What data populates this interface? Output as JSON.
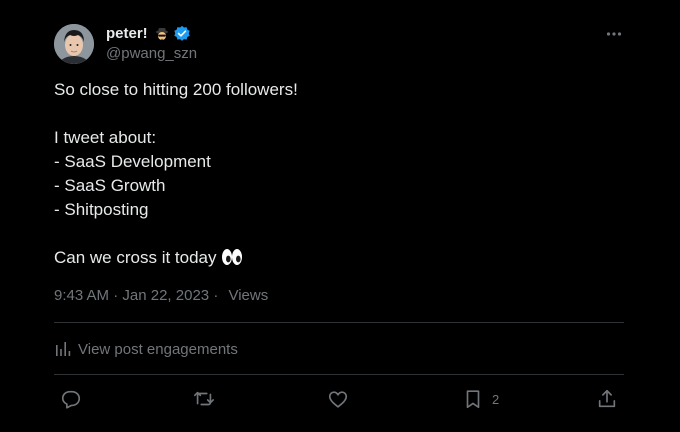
{
  "author": {
    "display_name": "peter!",
    "handle": "@pwang_szn",
    "avatar": "avatar-photo",
    "verified_icon": "verified-badge-icon",
    "name_emoji": "spy-emoji"
  },
  "post": {
    "lines": [
      "So close to hitting 200 followers!",
      "",
      "I tweet about:",
      "- SaaS Development",
      "- SaaS Growth",
      "- Shitposting",
      "",
      "Can we cross it today"
    ],
    "trailing_emoji": "eyes-emoji",
    "time": "9:43 AM",
    "separator": "·",
    "date": "Jan 22, 2023",
    "views_separator": "·",
    "views_label": "Views"
  },
  "engagements": {
    "label": "View post engagements"
  },
  "actions": {
    "reply_icon": "reply-icon",
    "repost_icon": "repost-icon",
    "like_icon": "like-icon",
    "bookmark_icon": "bookmark-icon",
    "bookmark_count": "2",
    "share_icon": "share-icon"
  },
  "colors": {
    "background": "#000000",
    "text_primary": "#e7e9ea",
    "text_secondary": "#71767b",
    "divider": "#2f3336",
    "verified": "#1d9bf0"
  }
}
